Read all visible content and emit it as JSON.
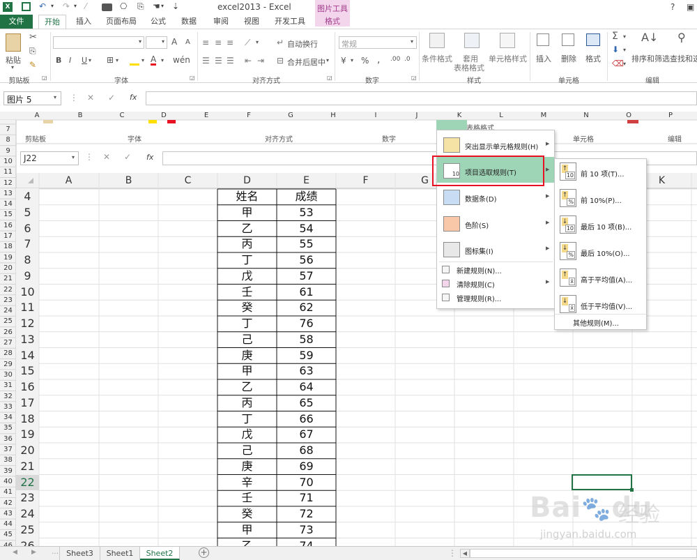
{
  "app": {
    "title": "excel2013 - Excel",
    "context_label": "图片工具",
    "help": "?"
  },
  "tabs": [
    "文件",
    "开始",
    "插入",
    "页面布局",
    "公式",
    "数据",
    "审阅",
    "视图",
    "开发工具",
    "格式"
  ],
  "ribbon": {
    "clipboard": {
      "paste": "粘贴",
      "group": "剪贴板"
    },
    "font": {
      "group": "字体",
      "grow": "A",
      "shrink": "A",
      "bold": "B",
      "italic": "I",
      "underline": "U",
      "font_color": "A"
    },
    "alignment": {
      "wrap": "自动换行",
      "merge": "合并后居中",
      "group": "对齐方式"
    },
    "number": {
      "format": "常规",
      "pct": "%",
      "comma": ",",
      "group": "数字"
    },
    "styles": {
      "cond": "条件格式",
      "table": "套用",
      "table2": "表格格式",
      "cell": "单元格样式",
      "group": "样式"
    },
    "cells": {
      "insert": "插入",
      "delete": "删除",
      "format": "格式",
      "group": "单元格"
    },
    "editing": {
      "sort": "排序和筛选",
      "find": "查找和选",
      "group": "编辑"
    }
  },
  "namebox": "图片 5",
  "formula": {
    "fx": "fx"
  },
  "picture": {
    "top_col_headers": [
      "A",
      "B",
      "C",
      "D",
      "E",
      "F",
      "G",
      "H",
      "I",
      "J",
      "K",
      "L",
      "M",
      "N",
      "O",
      "P"
    ],
    "top_group_labels": [
      "剪贴板",
      "字体",
      "对齐方式",
      "数字",
      "单元格",
      "编辑"
    ],
    "table_fmt_fragment": "表格格式",
    "namebox": "J22",
    "fx": "fx",
    "col_headers": [
      "A",
      "B",
      "C",
      "D",
      "E",
      "F",
      "G",
      "H",
      "I",
      "J",
      "K"
    ],
    "outer_rows": [
      "7",
      "8",
      "9",
      "10",
      "11",
      "12",
      "13",
      "14",
      "15",
      "16",
      "17",
      "18",
      "19",
      "20",
      "21",
      "22",
      "23",
      "24",
      "25",
      "26",
      "27",
      "28",
      "29",
      "30",
      "31",
      "32",
      "33",
      "34",
      "35",
      "36",
      "37",
      "38",
      "39",
      "40",
      "41",
      "42",
      "43",
      "44",
      "45",
      "46"
    ],
    "inner_rows": [
      "4",
      "5",
      "6",
      "7",
      "8",
      "9",
      "10",
      "11",
      "12",
      "13",
      "14",
      "15",
      "16",
      "17",
      "18",
      "19",
      "20",
      "21",
      "22",
      "23",
      "24",
      "25",
      "26"
    ],
    "table": {
      "header": [
        "姓名",
        "成绩"
      ],
      "rows": [
        [
          "甲",
          "53"
        ],
        [
          "乙",
          "54"
        ],
        [
          "丙",
          "55"
        ],
        [
          "丁",
          "56"
        ],
        [
          "戊",
          "57"
        ],
        [
          "壬",
          "61"
        ],
        [
          "癸",
          "62"
        ],
        [
          "丁",
          "76"
        ],
        [
          "己",
          "58"
        ],
        [
          "庚",
          "59"
        ],
        [
          "甲",
          "63"
        ],
        [
          "乙",
          "64"
        ],
        [
          "丙",
          "65"
        ],
        [
          "丁",
          "66"
        ],
        [
          "戊",
          "67"
        ],
        [
          "己",
          "68"
        ],
        [
          "庚",
          "69"
        ],
        [
          "辛",
          "70"
        ],
        [
          "壬",
          "71"
        ],
        [
          "癸",
          "72"
        ],
        [
          "甲",
          "73"
        ],
        [
          "乙",
          "74"
        ]
      ]
    },
    "cond_menu": [
      {
        "label": "突出显示单元格规则(H)",
        "icon": "highlight-rules-icon"
      },
      {
        "label": "项目选取规则(T)",
        "icon": "top-bottom-rules-icon"
      },
      {
        "label": "数据条(D)",
        "icon": "data-bars-icon"
      },
      {
        "label": "色阶(S)",
        "icon": "color-scales-icon"
      },
      {
        "label": "图标集(I)",
        "icon": "icon-sets-icon"
      },
      {
        "label": "新建规则(N)...",
        "icon": "new-rule-icon"
      },
      {
        "label": "清除规则(C)",
        "icon": "clear-rules-icon"
      },
      {
        "label": "管理规则(R)...",
        "icon": "manage-rules-icon"
      }
    ],
    "sub_menu": [
      {
        "label": "前 10 项(T)...",
        "tag": "10"
      },
      {
        "label": "前 10%(P)...",
        "tag": "%"
      },
      {
        "label": "最后 10 项(B)...",
        "tag": "10"
      },
      {
        "label": "最后 10%(O)...",
        "tag": "%"
      },
      {
        "label": "高于平均值(A)...",
        "tag": "x̄"
      },
      {
        "label": "低于平均值(V)...",
        "tag": "x̄"
      },
      {
        "label": "其他规则(M)..."
      }
    ],
    "watermark": {
      "brand": "Bai",
      "brand2": "du",
      "cn": "经验",
      "url": "jingyan.baidu.com"
    }
  },
  "sheets": [
    "Sheet3",
    "Sheet1",
    "Sheet2"
  ],
  "colors": {
    "excel_green": "#217346",
    "hover": "#9fd5b7",
    "highlight": "#e81123",
    "gridline": "#d4d4d4"
  }
}
